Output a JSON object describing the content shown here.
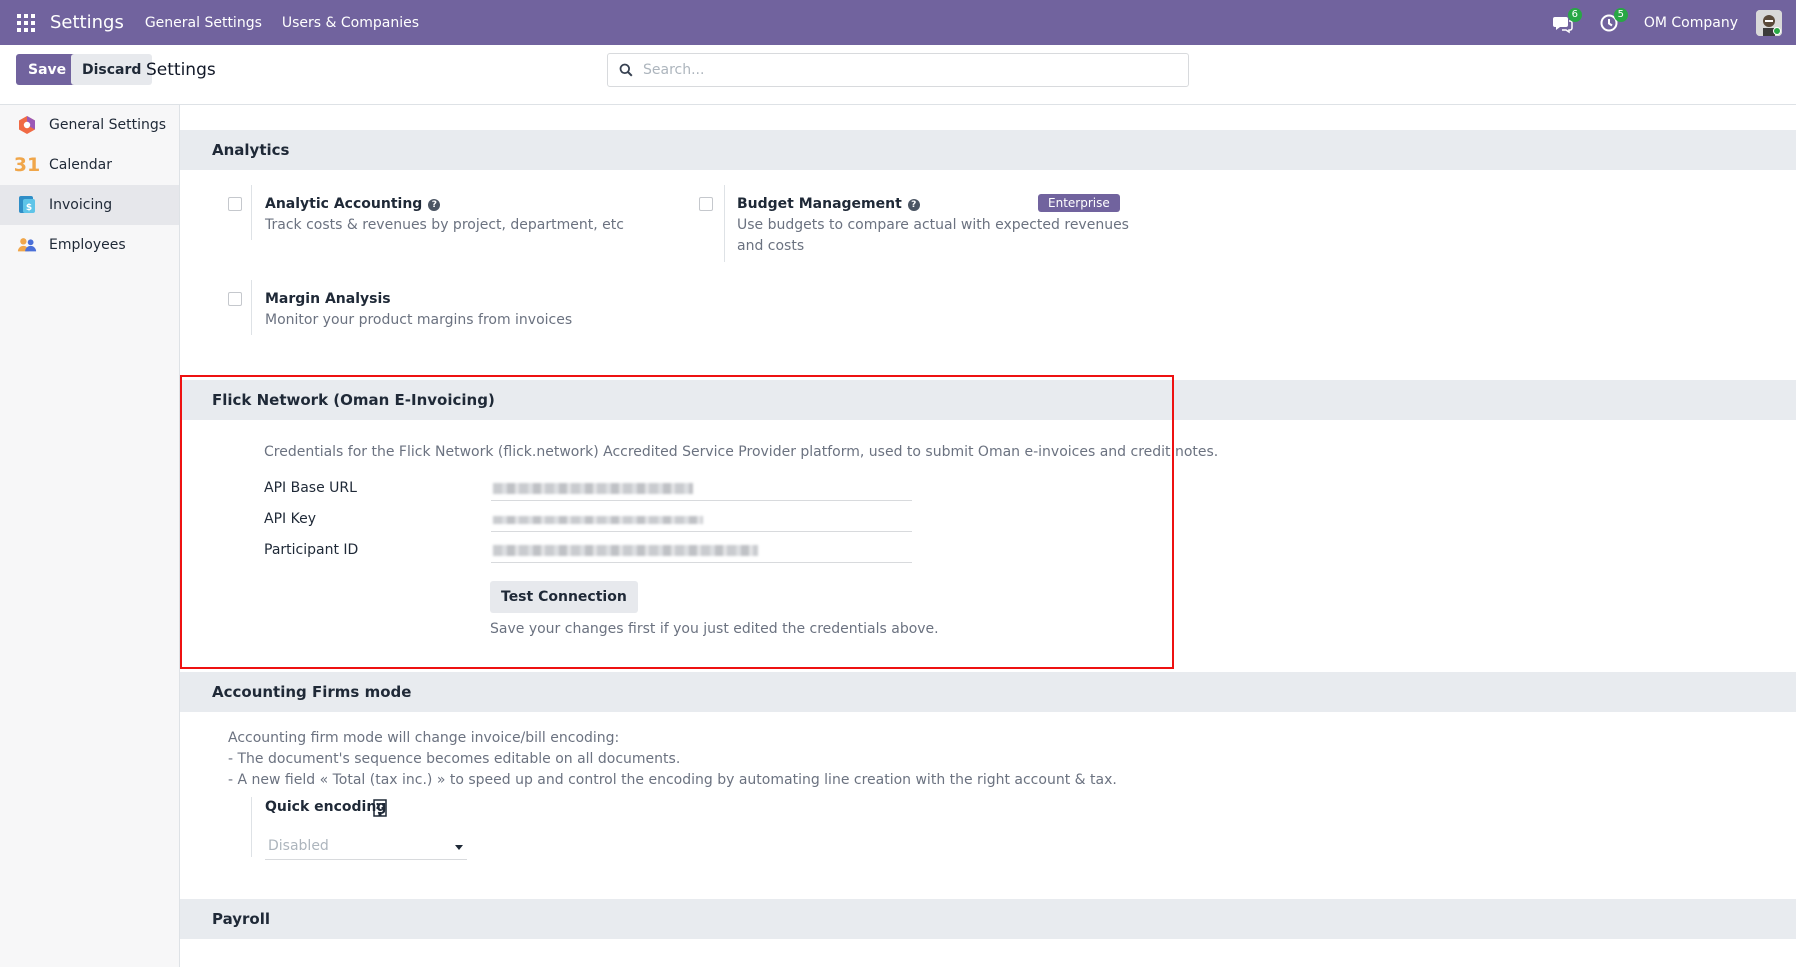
{
  "navbar": {
    "app_title": "Settings",
    "menu": [
      "General Settings",
      "Users & Companies"
    ],
    "messages_count": "6",
    "activities_count": "5",
    "company": "OM Company"
  },
  "control_panel": {
    "save_label": "Save",
    "discard_label": "Discard",
    "title": "Settings",
    "search_placeholder": "Search..."
  },
  "sidebar": {
    "items": [
      {
        "label": "General Settings",
        "icon": "general-settings-icon"
      },
      {
        "label": "Calendar",
        "icon": "calendar-icon",
        "icon_text": "31"
      },
      {
        "label": "Invoicing",
        "icon": "invoicing-icon",
        "active": true
      },
      {
        "label": "Employees",
        "icon": "employees-icon"
      }
    ]
  },
  "analytics": {
    "title": "Analytics",
    "analytic_accounting": {
      "label": "Analytic Accounting",
      "desc": "Track costs & revenues by project, department, etc"
    },
    "budget_management": {
      "label": "Budget Management",
      "badge": "Enterprise",
      "desc": "Use budgets to compare actual with expected revenues and costs"
    },
    "margin_analysis": {
      "label": "Margin Analysis",
      "desc": "Monitor your product margins from invoices"
    }
  },
  "flick": {
    "title": "Flick Network (Oman E-Invoicing)",
    "desc": "Credentials for the Flick Network (flick.network) Accredited Service Provider platform, used to submit Oman e-invoices and credit notes.",
    "fields": [
      "API Base URL",
      "API Key",
      "Participant ID"
    ],
    "test_button": "Test Connection",
    "hint": "Save your changes first if you just edited the credentials above."
  },
  "accounting_firms": {
    "title": "Accounting Firms mode",
    "desc_lines": [
      "Accounting firm mode will change invoice/bill encoding:",
      "- The document's sequence becomes editable on all documents.",
      "- A new field « Total (tax inc.) » to speed up and control the encoding by automating line creation with the right account & tax."
    ],
    "quick_encoding_label": "Quick encoding",
    "quick_encoding_value": "Disabled"
  },
  "payroll": {
    "title": "Payroll"
  },
  "colors": {
    "brand": "#71639e",
    "badge": "#28a745",
    "highlight": "#ee1111"
  }
}
